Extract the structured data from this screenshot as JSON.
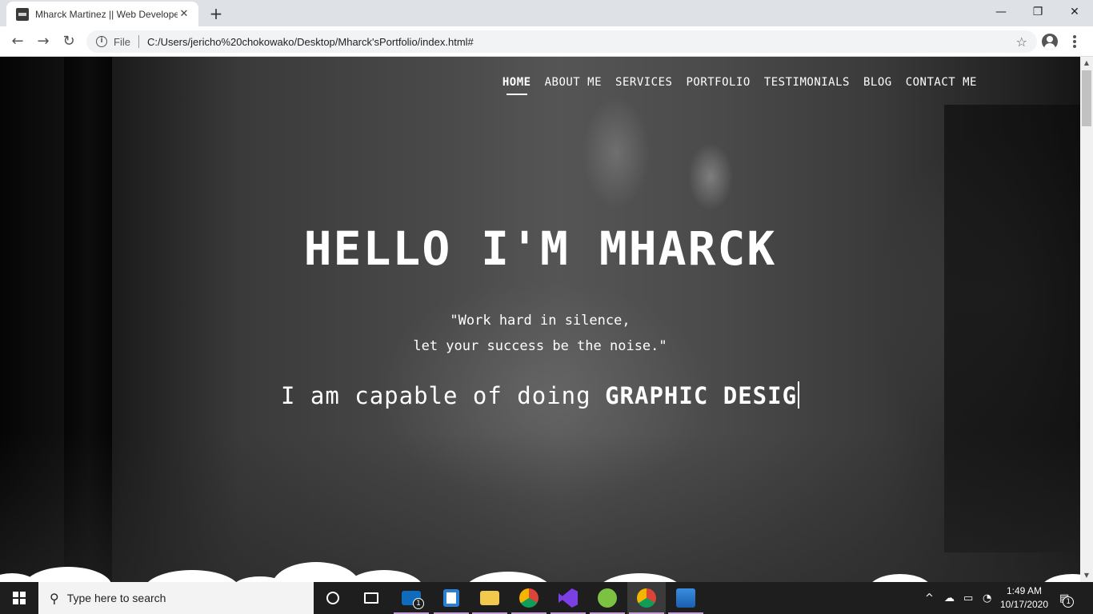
{
  "browser": {
    "tab_title": "Mharck Martinez || Web Developer",
    "tab_close": "✕",
    "new_tab": "+",
    "window_controls": {
      "minimize": "—",
      "maximize": "❐",
      "close": "✕"
    },
    "back": "←",
    "forward": "→",
    "reload": "↻",
    "info_icon": "i",
    "scheme_label": "File",
    "url": "C:/Users/jericho%20chokowako/Desktop/Mharck'sPortfolio/index.html#",
    "bookmark_star": "☆"
  },
  "page": {
    "nav": [
      {
        "label": "HOME",
        "active": true
      },
      {
        "label": "ABOUT ME"
      },
      {
        "label": "SERVICES"
      },
      {
        "label": "PORTFOLIO"
      },
      {
        "label": "TESTIMONIALS"
      },
      {
        "label": "BLOG"
      },
      {
        "label": "CONTACT ME"
      }
    ],
    "hero_title": "HELLO I'M MHARCK",
    "quote_line1": "\"Work hard in silence,",
    "quote_line2": "let your success be the noise.\"",
    "typing_lead": "I am capable of doing",
    "typing_text": "GRAPHIC DESIG"
  },
  "taskbar": {
    "search_placeholder": "Type here to search",
    "search_icon": "⚲",
    "mail_badge": "1",
    "time": "1:49 AM",
    "date": "10/17/2020",
    "notification_badge": "1",
    "tray_chevron": "^",
    "apps": [
      "cortana",
      "task-view",
      "mail",
      "store",
      "file-explorer",
      "chrome",
      "visual-studio",
      "dreamweaver-app",
      "chrome-active",
      "photos"
    ]
  },
  "colors": {
    "tabstrip": "#dee1e6",
    "taskbar": "#1e1e1e",
    "hero_text": "#ffffff",
    "running_indicator": "#c49fd8"
  }
}
